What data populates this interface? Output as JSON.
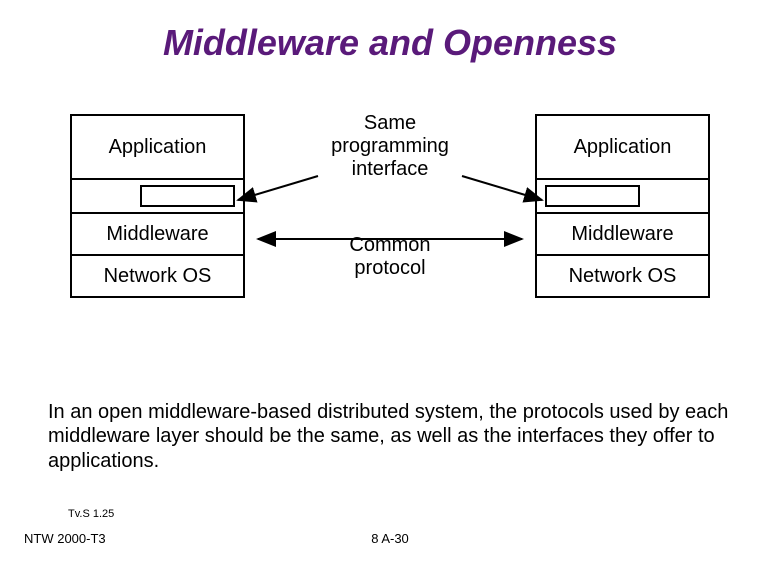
{
  "title": "Middleware and Openness",
  "stacks": {
    "left": {
      "app": "Application",
      "middleware": "Middleware",
      "netos": "Network OS"
    },
    "right": {
      "app": "Application",
      "middleware": "Middleware",
      "netos": "Network OS"
    }
  },
  "labels": {
    "interface": "Same\nprogramming\ninterface",
    "protocol": "Common\nprotocol"
  },
  "body": "In an open middleware-based distributed system, the protocols used by each middleware layer should be the same, as well as the interfaces they offer to applications.",
  "footnotes": {
    "tvs": "Tv.S 1.25",
    "ntw": "NTW 2000-T3",
    "page": "8 A-30"
  }
}
